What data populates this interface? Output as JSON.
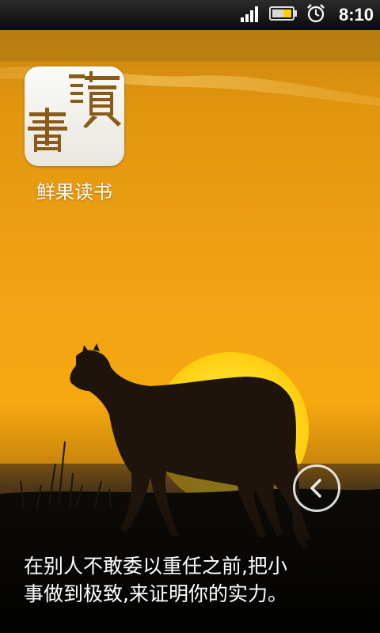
{
  "status_bar": {
    "time": "8:10",
    "signal_icon": "signal-bars-icon",
    "battery_icon": "battery-icon",
    "alarm_icon": "alarm-clock-icon"
  },
  "app": {
    "name": "鲜果读书",
    "logo_icon": "book-reading-logo",
    "logo_characters": "讀書"
  },
  "quote": {
    "line1": "在别人不敢委以重任之前,把小",
    "line2": "事做到极致,来证明你的实力。"
  },
  "navigation": {
    "back_icon": "chevron-left-icon"
  },
  "colors": {
    "sky_top": "#d9890d",
    "sky_mid": "#f2a314",
    "horizon": "#f0b010",
    "sun": "#ffe030",
    "text": "#ffffff"
  }
}
